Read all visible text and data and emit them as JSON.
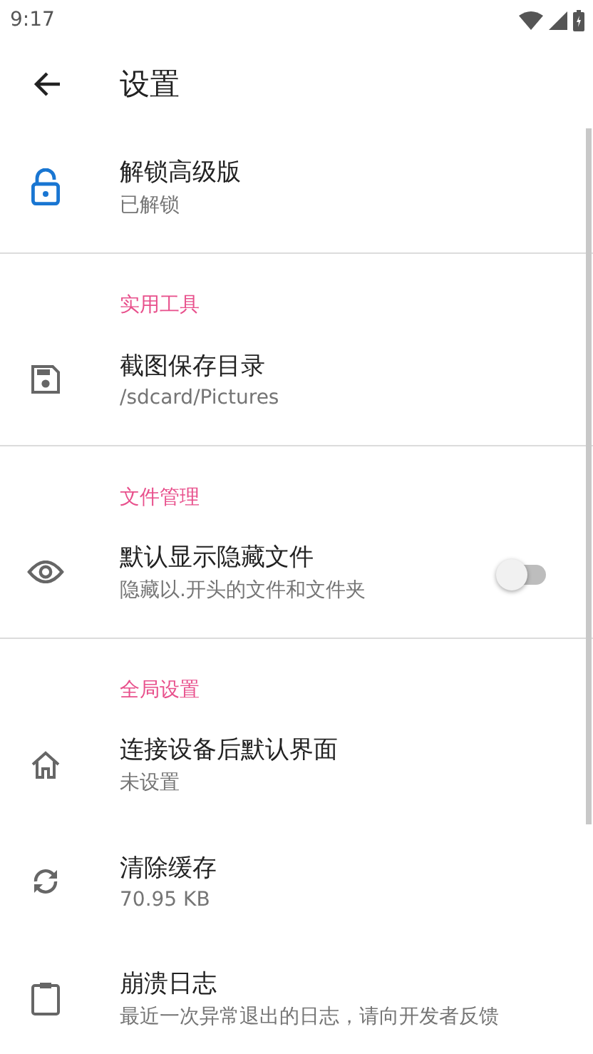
{
  "status_bar": {
    "time": "9:17"
  },
  "toolbar": {
    "title": "设置"
  },
  "groups": [
    {
      "items": [
        {
          "kind": "item",
          "title": "解锁高级版",
          "subtitle": "已解锁"
        }
      ]
    },
    {
      "category": "实用工具",
      "items": [
        {
          "kind": "item",
          "title": "截图保存目录",
          "subtitle": "/sdcard/Pictures"
        }
      ]
    },
    {
      "category": "文件管理",
      "items": [
        {
          "kind": "switch",
          "title": "默认显示隐藏文件",
          "subtitle": "隐藏以.开头的文件和文件夹",
          "on": false
        }
      ]
    },
    {
      "category": "全局设置",
      "items": [
        {
          "kind": "item",
          "title": "连接设备后默认界面",
          "subtitle": "未设置"
        },
        {
          "kind": "item",
          "title": "清除缓存",
          "subtitle": "70.95 KB"
        },
        {
          "kind": "item",
          "title": "崩溃日志",
          "subtitle": "最近一次异常退出的日志，请向开发者反馈"
        }
      ]
    }
  ]
}
